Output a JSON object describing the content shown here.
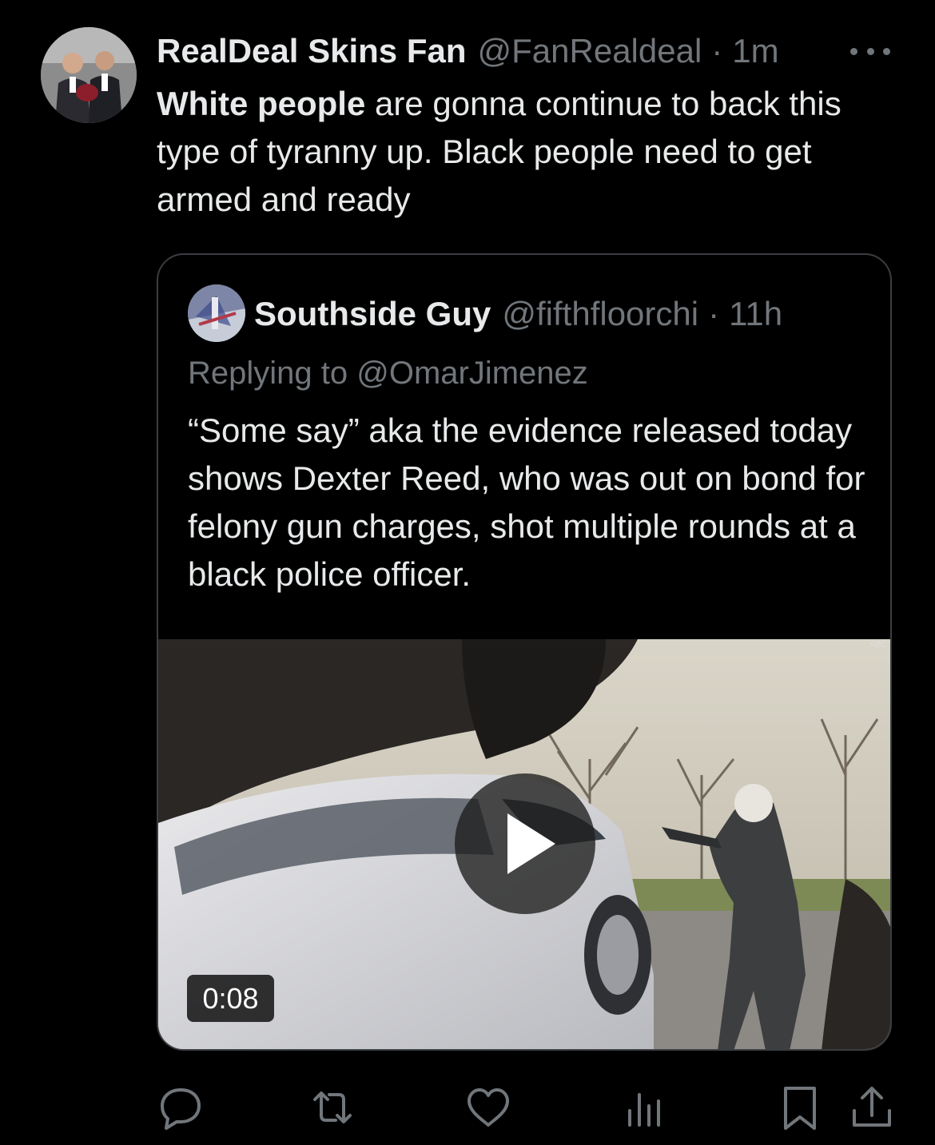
{
  "tweet": {
    "author_name": "RealDeal Skins Fan",
    "author_handle": "@FanRealdeal",
    "separator": "·",
    "time": "1m",
    "text_bold": "White people",
    "text_rest": " are gonna continue to back this type of tyranny up. Black people need to get armed and ready",
    "more_icon": "more-horizontal-icon"
  },
  "quoted_tweet": {
    "author_name": "Southside Guy",
    "author_handle": "@fifthfloorchi",
    "separator": "·",
    "time": "11h",
    "reply_context": "Replying to @OmarJimenez",
    "text": "“Some say” aka the evidence released today shows Dexter Reed, who was out on bond for felony gun charges, shot multiple rounds at a black police officer.",
    "media": {
      "type": "video",
      "duration": "0:08",
      "play_icon": "play-icon"
    }
  },
  "actions": [
    {
      "name": "reply",
      "icon": "reply-icon"
    },
    {
      "name": "retweet",
      "icon": "retweet-icon"
    },
    {
      "name": "like",
      "icon": "heart-icon"
    },
    {
      "name": "views",
      "icon": "views-chart-icon"
    },
    {
      "name": "bookmark",
      "icon": "bookmark-icon"
    },
    {
      "name": "share",
      "icon": "share-icon"
    }
  ],
  "colors": {
    "background": "#000000",
    "primary_text": "#e7e9ea",
    "secondary_text": "#71767b",
    "border": "#3a3d41"
  }
}
